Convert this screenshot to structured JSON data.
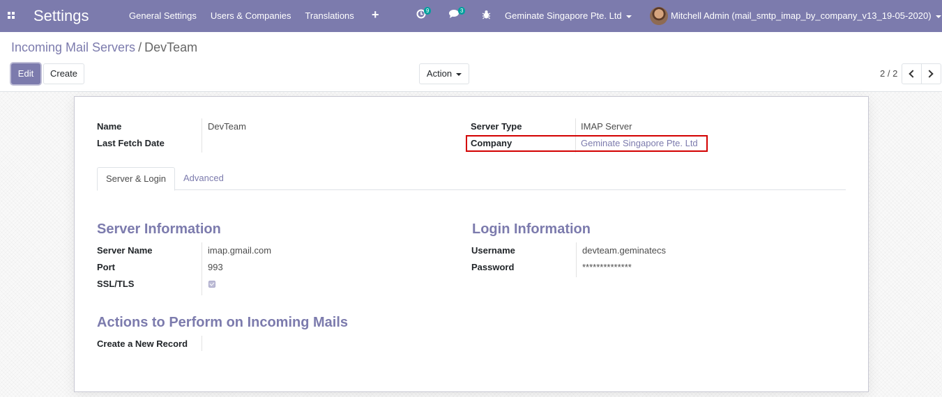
{
  "navbar": {
    "app_title": "Settings",
    "menu": [
      "General Settings",
      "Users & Companies",
      "Translations"
    ],
    "plus_icon": "plus-icon",
    "activity_count": "9",
    "messages_count": "3",
    "company": "Geminate Singapore Pte. Ltd",
    "user": "Mitchell Admin (mail_smtp_imap_by_company_v13_19-05-2020)",
    "color": "#7c7bad"
  },
  "breadcrumb": {
    "parent": "Incoming Mail Servers",
    "separator": "/",
    "current": "DevTeam"
  },
  "toolbar": {
    "edit": "Edit",
    "create": "Create",
    "action": "Action"
  },
  "pager": {
    "value": "2 / 2"
  },
  "form": {
    "name_label": "Name",
    "name": "DevTeam",
    "last_fetch_label": "Last Fetch Date",
    "last_fetch": "",
    "server_type_label": "Server Type",
    "server_type": "IMAP Server",
    "company_label": "Company",
    "company": "Geminate Singapore Pte. Ltd",
    "tabs": [
      "Server & Login",
      "Advanced"
    ],
    "server_info_title": "Server Information",
    "server_name_label": "Server Name",
    "server_name": "imap.gmail.com",
    "port_label": "Port",
    "port": "993",
    "ssl_label": "SSL/TLS",
    "ssl_checked": true,
    "login_info_title": "Login Information",
    "username_label": "Username",
    "username": "devteam.geminatecs",
    "password_label": "Password",
    "password": "**************",
    "actions_title": "Actions to Perform on Incoming Mails",
    "create_record_label": "Create a New Record",
    "create_record": ""
  },
  "highlight_color": "#d30000"
}
